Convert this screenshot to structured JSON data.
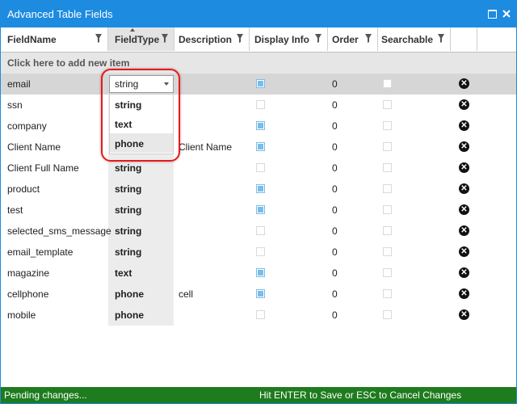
{
  "window": {
    "title": "Advanced Table Fields"
  },
  "columns": [
    {
      "label": "FieldName"
    },
    {
      "label": "FieldType"
    },
    {
      "label": "Description"
    },
    {
      "label": "Display Info"
    },
    {
      "label": "Order"
    },
    {
      "label": "Searchable"
    }
  ],
  "add_row_label": "Click here to add new item",
  "rows": [
    {
      "name": "email",
      "type": "string",
      "description": "",
      "display": true,
      "order": "0",
      "searchable": false
    },
    {
      "name": "ssn",
      "type": "string",
      "description": "",
      "display": false,
      "order": "0",
      "searchable": false
    },
    {
      "name": "company",
      "type": "string",
      "description": "",
      "display": true,
      "order": "0",
      "searchable": false
    },
    {
      "name": "Client Name",
      "type": "string",
      "description": "Client Name",
      "display": true,
      "order": "0",
      "searchable": false
    },
    {
      "name": "Client Full Name",
      "type": "string",
      "description": "",
      "display": false,
      "order": "0",
      "searchable": false
    },
    {
      "name": "product",
      "type": "string",
      "description": "",
      "display": true,
      "order": "0",
      "searchable": false
    },
    {
      "name": "test",
      "type": "string",
      "description": "",
      "display": true,
      "order": "0",
      "searchable": false
    },
    {
      "name": "selected_sms_message",
      "type": "string",
      "description": "",
      "display": false,
      "order": "0",
      "searchable": false
    },
    {
      "name": "email_template",
      "type": "string",
      "description": "",
      "display": false,
      "order": "0",
      "searchable": false
    },
    {
      "name": "magazine",
      "type": "text",
      "description": "",
      "display": true,
      "order": "0",
      "searchable": false
    },
    {
      "name": "cellphone",
      "type": "phone",
      "description": "cell",
      "display": true,
      "order": "0",
      "searchable": false
    },
    {
      "name": "mobile",
      "type": "phone",
      "description": "",
      "display": false,
      "order": "0",
      "searchable": false
    }
  ],
  "editor": {
    "value": "string",
    "options": [
      "string",
      "text",
      "phone"
    ],
    "hovered": "phone"
  },
  "status": {
    "left": "Pending changes...",
    "right": "Hit ENTER to Save or ESC to Cancel Changes"
  },
  "colors": {
    "titlebar": "#1c8be0",
    "statusbar": "#1e7b1e",
    "highlight": "#e31b1b",
    "checked": "#7bbce8"
  }
}
